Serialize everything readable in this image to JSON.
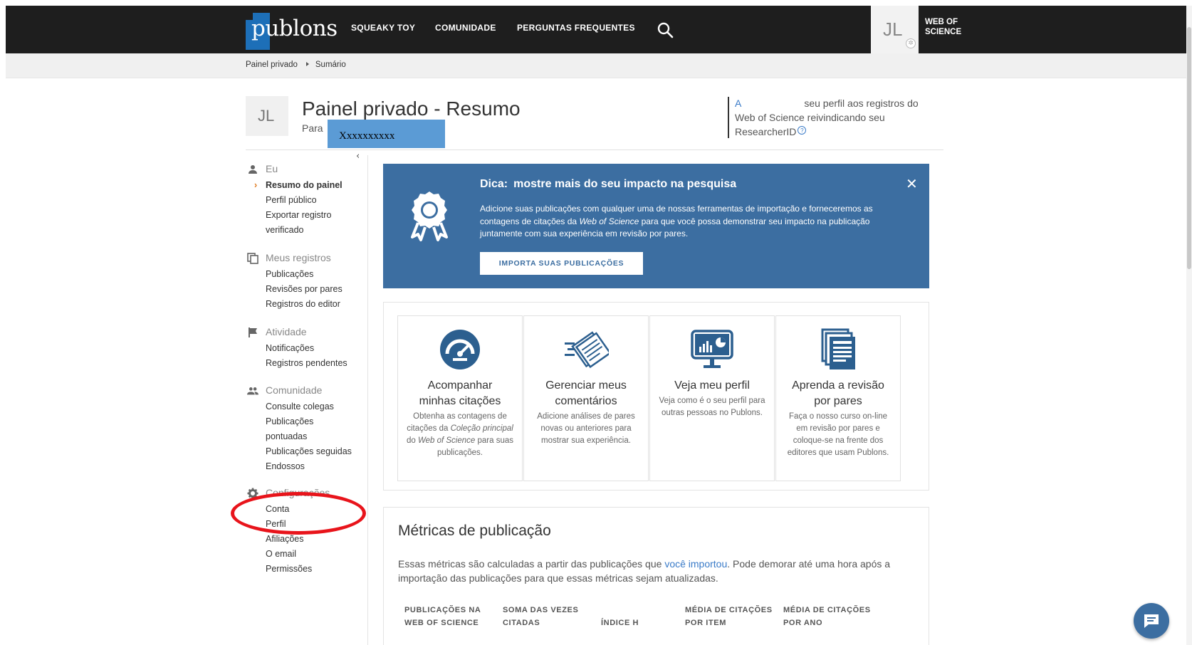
{
  "nav": {
    "logo": "publons",
    "links": [
      "SQUEAKY TOY",
      "COMUNIDADE",
      "PERGUNTAS FREQUENTES"
    ],
    "user_initials": "JL",
    "wos_line1": "WEB OF",
    "wos_line2": "SCIENCE"
  },
  "breadcrumb": [
    "Painel privado",
    "Sumário"
  ],
  "header": {
    "avatar_initials": "JL",
    "title": "Painel privado - Resumo",
    "for_label": "Para",
    "redacted_name": "Xxxxxxxxxx",
    "claim_link": "A",
    "claim_text_1": "seu perfil aos registros do",
    "claim_text_2": "Web of Science reivindicando seu",
    "claim_text_3": "ResearcherID"
  },
  "sidebar": {
    "sections": [
      {
        "label": "Eu",
        "icon": "person-icon",
        "items": [
          {
            "label": "Resumo do painel",
            "active": true
          },
          {
            "label": "Perfil público"
          },
          {
            "label": "Exportar registro"
          },
          {
            "label": "verificado"
          }
        ]
      },
      {
        "label": "Meus registros",
        "icon": "copy-icon",
        "items": [
          {
            "label": "Publicações"
          },
          {
            "label": "Revisões por pares"
          },
          {
            "label": "Registros do editor"
          }
        ]
      },
      {
        "label": "Atividade",
        "icon": "flag-icon",
        "items": [
          {
            "label": "Notificações"
          },
          {
            "label": "Registros pendentes"
          }
        ]
      },
      {
        "label": "Comunidade",
        "icon": "people-icon",
        "items": [
          {
            "label": "Consulte colegas"
          },
          {
            "label": "Publicações"
          },
          {
            "label": "pontuadas"
          },
          {
            "label": "Publicações seguidas"
          },
          {
            "label": "Endossos"
          }
        ]
      },
      {
        "label": "Configurações",
        "icon": "gear-icon",
        "items": [
          {
            "label": "Conta"
          },
          {
            "label": "Perfil"
          },
          {
            "label": "Afiliações"
          },
          {
            "label": "O email"
          },
          {
            "label": "Permissões"
          }
        ]
      }
    ]
  },
  "tip": {
    "label": "Dica:",
    "title": "mostre mais do seu impacto na pesquisa",
    "body_1": "Adicione suas publicações com qualquer uma de nossas ferramentas de importação e forneceremos as contagens de citações da ",
    "body_em": "Web of Science",
    "body_2": " para que você possa demonstrar seu impacto na publicação juntamente com sua experiência em revisão por pares.",
    "button": "IMPORTA SUAS PUBLICAÇÕES"
  },
  "cards": [
    {
      "title_1": "Acompanhar",
      "title_2": "minhas citações",
      "desc_1": "Obtenha as contagens de citações da ",
      "desc_em1": "Coleção principal",
      "desc_2": " do ",
      "desc_em2": "Web of Science",
      "desc_3": " para suas publicações.",
      "icon": "speedometer-icon"
    },
    {
      "title_1": "Gerenciar meus",
      "title_2": "comentários",
      "desc": "Adicione análises de pares novas ou anteriores para mostrar sua experiência.",
      "icon": "documents-icon"
    },
    {
      "title_1": "Veja meu perfil",
      "desc": "Veja como é o seu perfil para outras pessoas no Publons.",
      "icon": "monitor-chart-icon"
    },
    {
      "title_1": "Aprenda a revisão",
      "title_2": "por pares",
      "desc": "Faça o nosso curso on-line em revisão por pares e coloque-se na frente dos editores que usam Publons.",
      "icon": "stacked-pages-icon"
    }
  ],
  "metrics": {
    "title": "Métricas de publicação",
    "desc_1": "Essas métricas são calculadas a partir das publicações que ",
    "desc_link": "você importou",
    "desc_2": ". Pode demorar até uma hora após a importação das publicações para que essas métricas sejam atualizadas.",
    "columns": [
      [
        "PUBLICAÇÕES NA",
        "WEB OF SCIENCE"
      ],
      [
        "SOMA DAS VEZES",
        "CITADAS"
      ],
      [
        "",
        "ÍNDICE H"
      ],
      [
        "MÉDIA DE CITAÇÕES",
        "POR ITEM"
      ],
      [
        "MÉDIA DE CITAÇÕES",
        "POR ANO"
      ]
    ]
  },
  "colors": {
    "brand_blue": "#3c6ea1",
    "topbar": "#1e1e1e",
    "accent_orange": "#e07a1f",
    "annotation_red": "#e8141b"
  }
}
